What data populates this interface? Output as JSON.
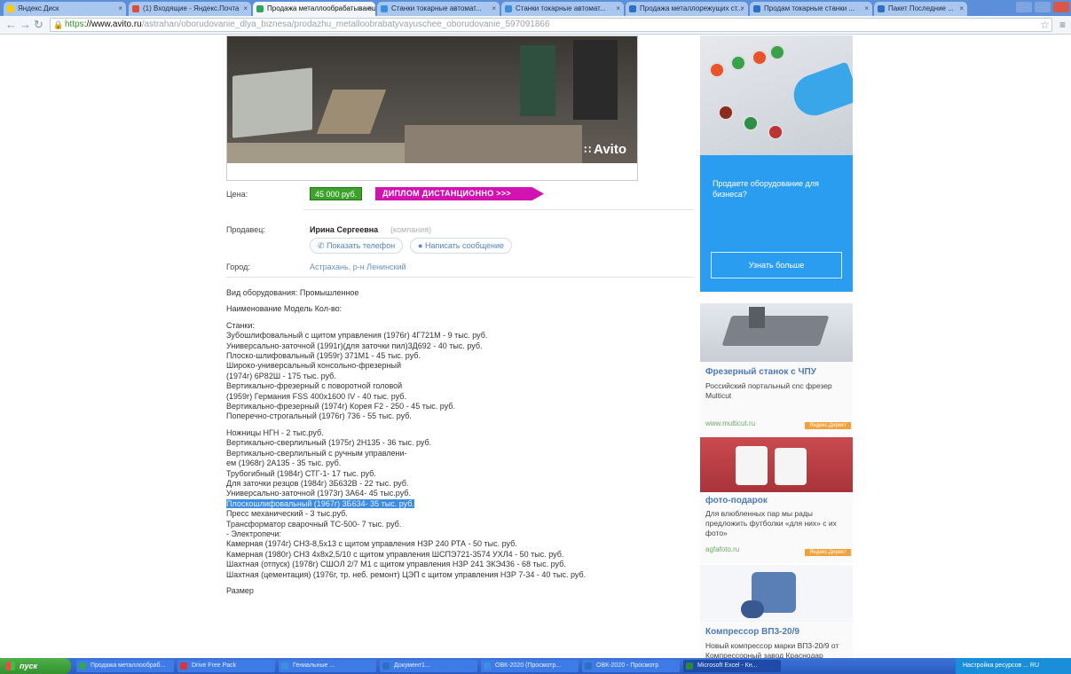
{
  "browser": {
    "tabs": [
      {
        "label": "Яндекс.Диск",
        "active": false,
        "color": "#ffcc00"
      },
      {
        "label": "(1) Входящие - Яндекс.Почта",
        "active": false,
        "color": "#e04b3b"
      },
      {
        "label": "Продажа металлообрабатывающего",
        "active": true,
        "color": "#2fa65b"
      },
      {
        "label": "Станки токарные автомат...",
        "active": false,
        "color": "#3b8fe0"
      },
      {
        "label": "Станки токарные автомат...",
        "active": false,
        "color": "#3b8fe0"
      },
      {
        "label": "Продажа металлорежущих ст...",
        "active": false,
        "color": "#2d6fc4"
      },
      {
        "label": "Продам токарные станки ...",
        "active": false,
        "color": "#2d6fc4"
      },
      {
        "label": "Пакет Последние ...",
        "active": false,
        "color": "#2d6fc4"
      }
    ],
    "url": {
      "scheme": "https",
      "host": "://www.avito.ru",
      "path": "/astrahan/oborudovanie_dlya_biznesa/prodazhu_metalloobrabatyvayuschee_oborudovanie_597091866"
    }
  },
  "listing": {
    "photo_watermark": "Avito",
    "labels": {
      "price": "Цена:",
      "seller": "Продавец:",
      "city": "Город:"
    },
    "price": "45 000 руб.",
    "promo": "ДИПЛОМ ДИСТАНЦИОННО >>>",
    "seller_name": "Ирина Сергеевна",
    "seller_type": "(компания)",
    "show_phone": "Показать телефон",
    "write_message": "Написать сообщение",
    "city": "Астрахань, р-н Ленинский",
    "description": [
      "Вид оборудования: Промышленное",
      "",
      "Наименование Модель Кол-во:",
      "",
      "Станки:",
      "Зубошлифовальный с щитом управления (1976г) 4Г721М - 9 тыс. руб.",
      "Универсально-заточной (1991г)(для заточки пил)3Д692 - 40 тыс. руб.",
      "Плоско-шлифовальный (1959г) 371М1 - 45 тыс. руб.",
      "Широко-универсальный консольно-фрезерный",
      "(1974г) 6Р82Ш - 175 тыс. руб.",
      "Вертикально-фрезерный с поворотной головой",
      "(1959г) Германия FSS 400х1600 IV - 40 тыс. руб.",
      "Вертикально-фрезерный (1974г) Корея F2 - 250 - 45 тыс. руб.",
      "Поперечно-строгальный (1976г) 736 - 55 тыс. руб.",
      "",
      "Ножницы НГН - 2 тыс.руб.",
      "Вертикально-сверлильный (1975г) 2Н135 - 36 тыс. руб.",
      "Вертикально-сверлильный с ручным управлени-",
      "ем (1968г) 2А135 - 35 тыс. руб.",
      "Трубогибный (1984г) СТГ-1- 17 тыс. руб.",
      "Для заточки резцов (1984г) 3Б632В - 22 тыс. руб.",
      "Универсально-заточной (1973г) 3А64- 45 тыс.руб.",
      "Плоскошлифовальный (1967г) 3Б634- 35 тыс. руб.",
      "Пресс механический - 3 тыс.руб.",
      "Трансформатор сварочный ТС-500- 7 тыс. руб.",
      "- Электропечи:",
      "Камерная (1974г) СНЗ-8,5х13 с щитом управления НЗР 240 РТА - 50 тыс. руб.",
      "Камерная (1980г) СНЗ 4х8х2,5/10 с щитом управления ШСПЭ721-3574 УХЛ4 - 50 тыс. руб.",
      "Шахтная (отпуск) (1978г) СШОЛ 2/7 М1 с щитом управления НЗР 241 ЗКЭ436 - 68 тыс. руб.",
      "Шахтная (цементация) (1976г, тр. неб. ремонт) ЦЭП с щитом управления НЗР 7-34 - 40 тыс. руб.",
      "",
      "Размер"
    ],
    "highlighted_line_index": 22
  },
  "ads": {
    "banner": {
      "text": "Продаете оборудование для бизнеса?",
      "button": "Узнать больше"
    },
    "cards": [
      {
        "title": "Фрезерный станок с ЧПУ",
        "text": "Российский портальный cnc фрезер Multicut",
        "domain": "www.multicut.ru",
        "mark": "Яндекс.Директ"
      },
      {
        "title": "фото-подарок",
        "text": "Для влюбленных пар мы рады предложить футболки «для них» с их фото»",
        "domain": "agfafoto.ru",
        "mark": "Яндекс.Директ"
      },
      {
        "title": "Компрессор ВП3-20/9",
        "text": "Новый компрессор марки ВП3-20/9 от Компрессорный завод Краснодар",
        "domain": "",
        "mark": ""
      }
    ]
  },
  "taskbar": {
    "start": "пуск",
    "tasks": [
      {
        "label": "Продажа металлообраб...",
        "color": "#2fa65b",
        "active": false
      },
      {
        "label": "Drive Free Pack",
        "color": "#d33",
        "active": false
      },
      {
        "label": "Гениальные ...",
        "color": "#3b8fe0",
        "active": false
      },
      {
        "label": "Документ1...",
        "color": "#2d6fc4",
        "active": false
      },
      {
        "label": "ОВК-2020 (Просмотр...",
        "color": "#3b8fe0",
        "active": false
      },
      {
        "label": "ОВК-2020 - Просмотр",
        "color": "#2d6fc4",
        "active": false
      },
      {
        "label": "Microsoft Excel - Кн...",
        "color": "#2a8a3a",
        "active": true
      }
    ],
    "tray": "Настройка ресурсов ...  RU"
  }
}
